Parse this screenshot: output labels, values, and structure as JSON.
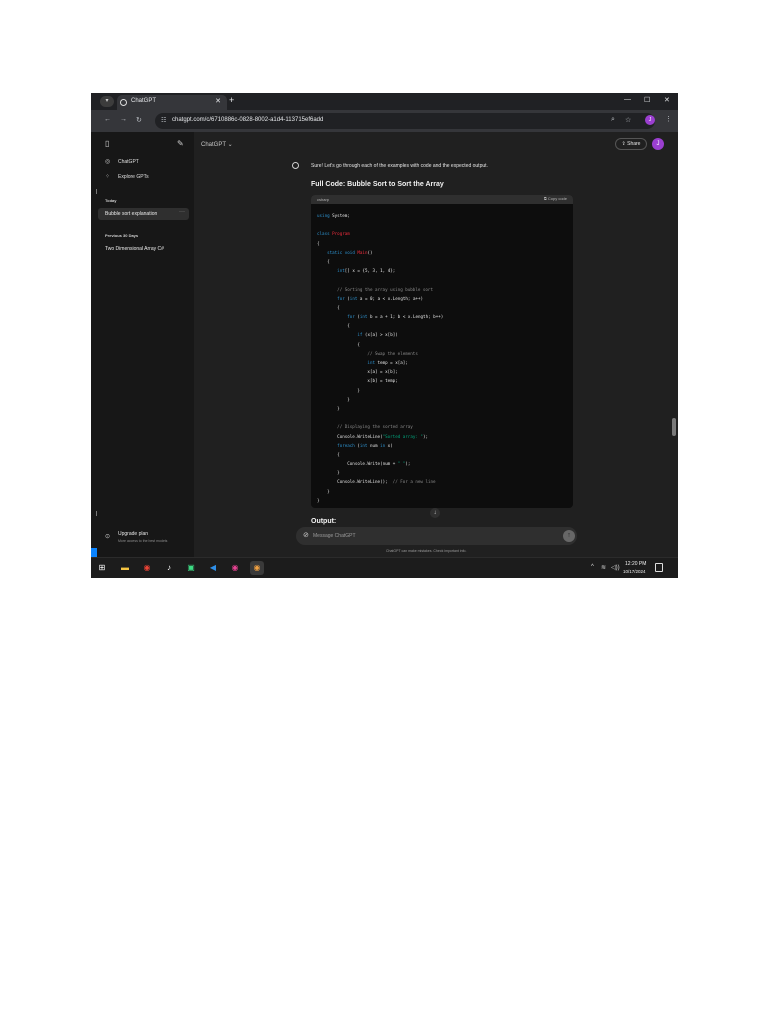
{
  "browser": {
    "tab_title": "ChatGPT",
    "url": "chatgpt.com/c/6710886c-0828-8002-a1d4-113715ef6add",
    "profile_initial": "J"
  },
  "sidebar": {
    "nav": [
      {
        "label": "ChatGPT",
        "icon": "chatgpt-logo-icon"
      },
      {
        "label": "Explore GPTs",
        "icon": "grid-icon"
      }
    ],
    "today_heading": "Today",
    "today_chats": [
      "Bubble sort explanation"
    ],
    "previous_heading": "Previous 30 Days",
    "previous_chats": [
      "Two Dimensional Array C#"
    ],
    "upgrade_title": "Upgrade plan",
    "upgrade_subtitle": "More access to the best models"
  },
  "header": {
    "model_label": "ChatGPT",
    "share_label": "Share",
    "avatar_initial": "J"
  },
  "conversation": {
    "intro": "Sure! Let's go through each of the examples with code and the expected output.",
    "heading": "Full Code: Bubble Sort to Sort the Array",
    "code_language": "csharp",
    "copy_label": "Copy code",
    "code_lines": [
      "using System;",
      "",
      "class Program",
      "{",
      "    static void Main()",
      "    {",
      "        int[] x = {5, 3, 1, 4};",
      "",
      "        // Sorting the array using bubble sort",
      "        for (int a = 0; a < x.Length; a++)",
      "        {",
      "            for (int b = a + 1; b < x.Length; b++)",
      "            {",
      "                if (x[a] > x[b])",
      "                {",
      "                    // Swap the elements",
      "                    int temp = x[a];",
      "                    x[a] = x[b];",
      "                    x[b] = temp;",
      "                }",
      "            }",
      "        }",
      "",
      "        // Displaying the sorted array",
      "        Console.WriteLine(\"Sorted array: \");",
      "        foreach (int num in x)",
      "        {",
      "            Console.Write(num + \" \");",
      "        }",
      "        Console.WriteLine();  // For a new line",
      "    }",
      "}"
    ],
    "output_heading": "Output:"
  },
  "composer": {
    "placeholder": "Message ChatGPT",
    "disclaimer": "ChatGPT can make mistakes. Check important info."
  },
  "taskbar": {
    "apps": [
      "start-icon",
      "file-explorer-icon",
      "chrome-icon",
      "tiktok-icon",
      "android-studio-icon",
      "vscode-icon",
      "chrome-profile-icon",
      "chrome-active-icon"
    ],
    "time": "12:20 PM",
    "date": "10/17/2024"
  },
  "colors": {
    "sidebar_bg": "#171717",
    "main_bg": "#202020",
    "code_bg": "#0d0d0d",
    "keyword": "#2e95d3",
    "class_name": "#f22c3d",
    "string": "#00a67d",
    "avatar": "#9b3fd0"
  }
}
